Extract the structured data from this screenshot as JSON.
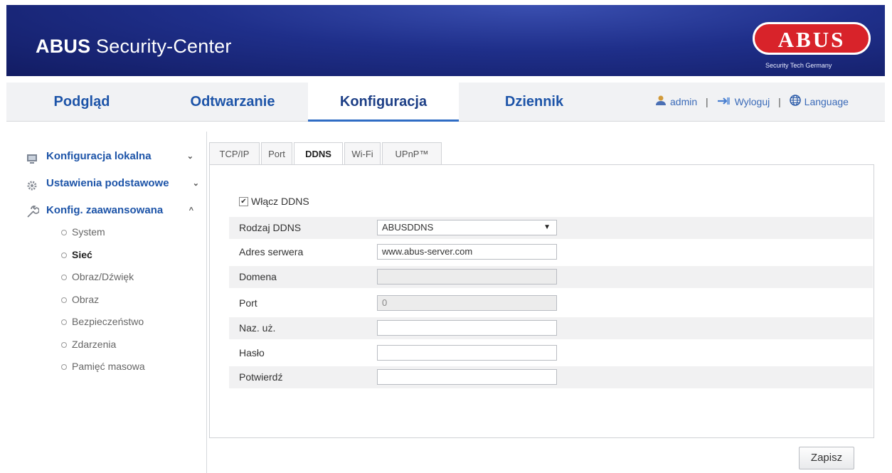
{
  "header": {
    "title_bold": "ABUS",
    "title_rest": " Security-Center",
    "logo_text": "ABUS",
    "logo_tagline": "Security Tech Germany",
    "brand_color": "#1f2f8a",
    "logo_color": "#d8232a"
  },
  "nav": {
    "tabs": [
      {
        "label": "Podgląd"
      },
      {
        "label": "Odtwarzanie"
      },
      {
        "label": "Konfiguracja"
      },
      {
        "label": "Dziennik"
      }
    ],
    "active_tab": "Konfiguracja",
    "user": "admin",
    "sep1": "|",
    "logout": "Wyloguj",
    "sep2": "|",
    "language": "Language"
  },
  "sidebar": {
    "sections": [
      {
        "label": "Konfiguracja lokalna",
        "icon": "monitor-icon",
        "chevron": "⌄"
      },
      {
        "label": "Ustawienia podstawowe",
        "icon": "gear-icon",
        "chevron": "⌄"
      },
      {
        "label": "Konfig. zaawansowana",
        "icon": "wrench-icon",
        "chevron": "^"
      }
    ],
    "items": [
      {
        "label": "System"
      },
      {
        "label": "Sieć"
      },
      {
        "label": "Obraz/Dźwięk"
      },
      {
        "label": "Obraz"
      },
      {
        "label": "Bezpieczeństwo"
      },
      {
        "label": "Zdarzenia"
      },
      {
        "label": "Pamięć masowa"
      }
    ],
    "active_item": "Sieć"
  },
  "tabs": [
    {
      "label": "TCP/IP"
    },
    {
      "label": "Port"
    },
    {
      "label": "DDNS"
    },
    {
      "label": "Wi-Fi"
    },
    {
      "label": "UPnP™"
    }
  ],
  "active_tab": "DDNS",
  "form": {
    "enable_label": "Włącz DDNS",
    "enable_checked": true,
    "rows": [
      {
        "label": "Rodzaj DDNS",
        "value": "ABUSDDNS"
      },
      {
        "label": "Adres serwera",
        "value": "www.abus-server.com"
      },
      {
        "label": "Domena",
        "value": ""
      },
      {
        "label": "Port",
        "value": "0"
      },
      {
        "label": "Naz. uż.",
        "value": ""
      },
      {
        "label": "Hasło",
        "value": ""
      },
      {
        "label": "Potwierdź",
        "value": ""
      }
    ]
  },
  "save_label": "Zapisz"
}
